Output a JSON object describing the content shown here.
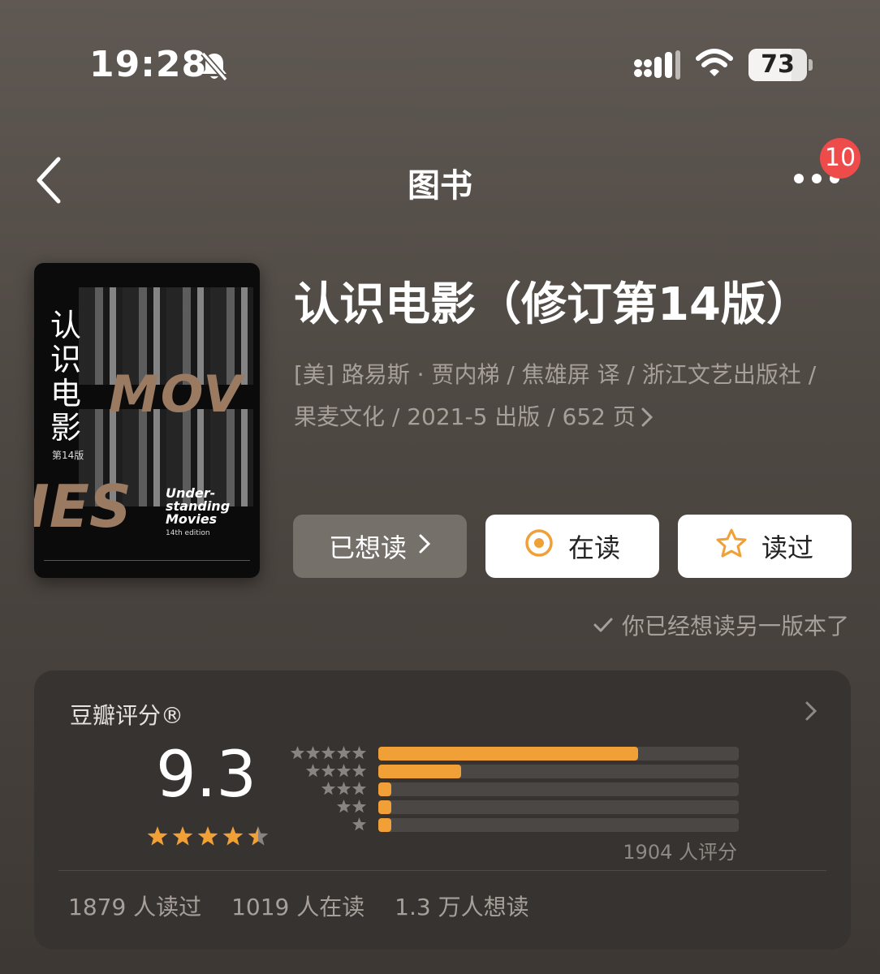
{
  "status_bar": {
    "time": "19:28",
    "battery": "73",
    "battery_level": 0.73
  },
  "nav": {
    "title": "图书",
    "notification_count": "10"
  },
  "cover": {
    "title_cn": "认识电影",
    "edition_cn": "第14版",
    "big_text_top": "MOV",
    "big_text_bottom": "IES",
    "title_en": "Under-\nstanding\nMovies",
    "edition_en": "14th edition"
  },
  "book": {
    "title": "认识电影（修订第14版）",
    "meta_line1": "[美] 路易斯 · 贾内梯 / 焦雄屏 译 / 浙江文艺出版社 /",
    "meta_line2": "果麦文化 / 2021-5 出版 / 652 页"
  },
  "actions": {
    "want": "已想读",
    "reading": "在读",
    "read": "读过",
    "note": "你已经想读另一版本了"
  },
  "rating": {
    "label": "豆瓣评分®",
    "score": "9.3",
    "score_value": 9.3,
    "stars": 4.5,
    "count_text": "1904 人评分",
    "distribution": [
      {
        "stars": 5,
        "fraction": 0.72
      },
      {
        "stars": 4,
        "fraction": 0.23
      },
      {
        "stars": 3,
        "fraction": 0.02
      },
      {
        "stars": 2,
        "fraction": 0.02
      },
      {
        "stars": 1,
        "fraction": 0.02
      }
    ],
    "stats": [
      "1879 人读过",
      "1019 人在读",
      "1.3 万人想读"
    ]
  },
  "colors": {
    "accent": "#f0a037",
    "badge": "#ee4b4b",
    "card": "#373331",
    "muted": "#a7a09a"
  }
}
